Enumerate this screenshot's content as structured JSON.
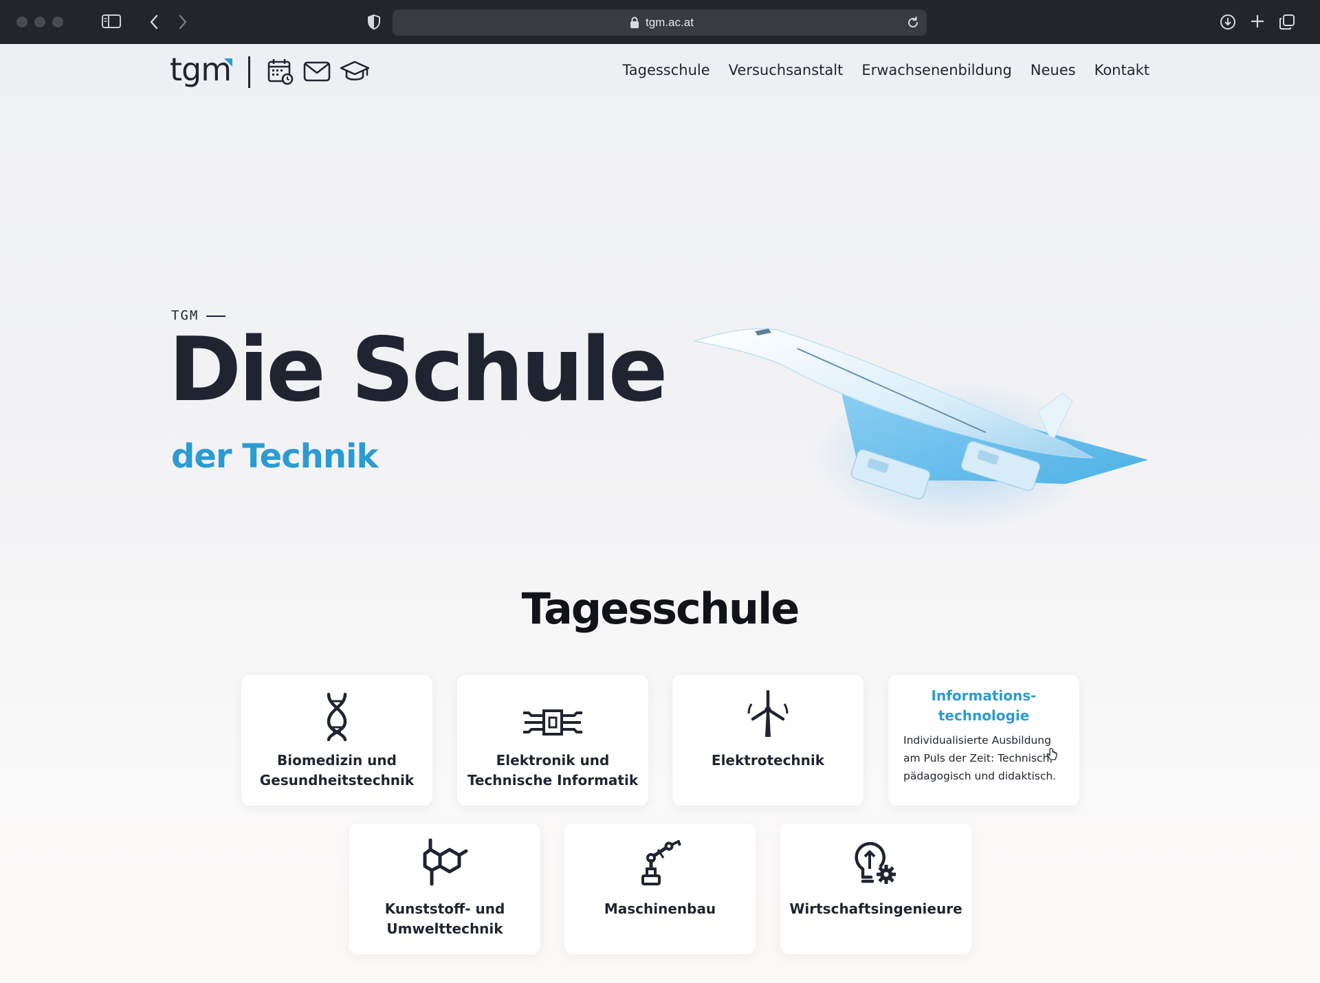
{
  "browser": {
    "url": "tgm.ac.at",
    "icons": [
      "sidebar-icon",
      "back-icon",
      "forward-icon",
      "shield-icon",
      "lock-icon",
      "reload-icon",
      "download-icon",
      "new-tab-icon",
      "tabs-overview-icon"
    ]
  },
  "header": {
    "logo_text": "tgm",
    "icons": [
      "calendar-icon",
      "mail-icon",
      "graduation-cap-icon"
    ],
    "nav": [
      "Tagesschule",
      "Versuchsanstalt",
      "Erwachsenenbildung",
      "Neues",
      "Kontakt"
    ]
  },
  "hero": {
    "eyebrow": "TGM",
    "title": "Die Schule",
    "subtitle": "der Technik"
  },
  "section": {
    "title": "Tagesschule",
    "cards": [
      {
        "label": "Biomedizin und Gesundheitstechnik",
        "icon": "dna-icon"
      },
      {
        "label": "Elektronik und Technische Informatik",
        "icon": "chip-icon"
      },
      {
        "label": "Elektrotechnik",
        "icon": "wind-turbine-icon"
      },
      {
        "label": "Informations-technologie",
        "icon": "",
        "description": "Individualisierte Ausbildung am Puls der Zeit: Technisch, pädagogisch und didaktisch."
      },
      {
        "label": "Kunststoff- und Umwelttechnik",
        "icon": "molecule-icon"
      },
      {
        "label": "Maschinenbau",
        "icon": "robot-arm-icon"
      },
      {
        "label": "Wirtschaftsingenieure",
        "icon": "lightbulb-gear-icon"
      }
    ]
  },
  "colors": {
    "accent": "#2b9bd3",
    "text": "#1f2430",
    "chrome": "#24252a"
  }
}
